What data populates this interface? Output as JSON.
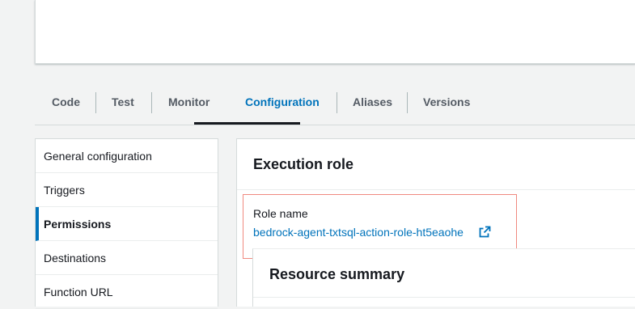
{
  "tabs": [
    {
      "label": "Code"
    },
    {
      "label": "Test"
    },
    {
      "label": "Monitor"
    },
    {
      "label": "Configuration"
    },
    {
      "label": "Aliases"
    },
    {
      "label": "Versions"
    }
  ],
  "active_tab": "Configuration",
  "side_nav": {
    "items": [
      {
        "label": "General configuration"
      },
      {
        "label": "Triggers"
      },
      {
        "label": "Permissions"
      },
      {
        "label": "Destinations"
      },
      {
        "label": "Function URL"
      }
    ],
    "active": "Permissions"
  },
  "execution_role": {
    "title": "Execution role",
    "role_name_label": "Role name",
    "role_name": "bedrock-agent-txtsql-action-role-ht5eaohe",
    "link_icon": "external-link-icon"
  },
  "resource_summary": {
    "title": "Resource summary"
  },
  "colors": {
    "accent": "#0073bb",
    "highlight": "#f08a80",
    "background": "#f2f3f3"
  }
}
